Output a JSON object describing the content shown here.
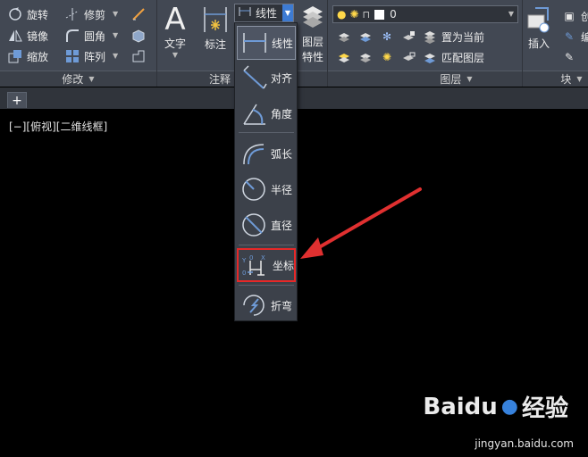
{
  "ribbon": {
    "modify": {
      "title": "修改",
      "tools": {
        "rotate": "旋转",
        "mirror": "镜像",
        "scale": "缩放",
        "trim": "修剪",
        "fillet": "圆角",
        "array": "阵列"
      }
    },
    "annotation": {
      "title": "注释",
      "text": "文字",
      "dimension": "标注",
      "linear_current": "线性"
    },
    "layers": {
      "title": "图层",
      "layer_props_line1": "图层",
      "layer_props_line2": "特性",
      "current_layer": "0",
      "set_current": "置为当前",
      "match_layer": "匹配图层"
    },
    "block": {
      "title": "块",
      "insert": "插入",
      "create_partial": "创",
      "edit_partial": "编"
    }
  },
  "tabs": {
    "add": "+"
  },
  "viewport": {
    "label": "[−][俯视][二维线框]"
  },
  "dim_menu": {
    "items": [
      {
        "label": "线性",
        "icon": "linear-dim-icon",
        "selected": true
      },
      {
        "label": "对齐",
        "icon": "aligned-dim-icon"
      },
      {
        "label": "角度",
        "icon": "angular-dim-icon"
      },
      {
        "label": "弧长",
        "icon": "arc-length-icon"
      },
      {
        "label": "半径",
        "icon": "radius-icon"
      },
      {
        "label": "直径",
        "icon": "diameter-icon"
      },
      {
        "label": "坐标",
        "icon": "ordinate-icon",
        "highlighted": true
      },
      {
        "label": "折弯",
        "icon": "jogged-icon"
      }
    ]
  },
  "watermark": {
    "brand": "Baidu",
    "cn": "经验",
    "url": "jingyan.baidu.com"
  },
  "colors": {
    "ribbon_bg": "#424853",
    "accent": "#3d7bd3",
    "highlight_box": "#e62828",
    "arrow": "#e03030"
  }
}
